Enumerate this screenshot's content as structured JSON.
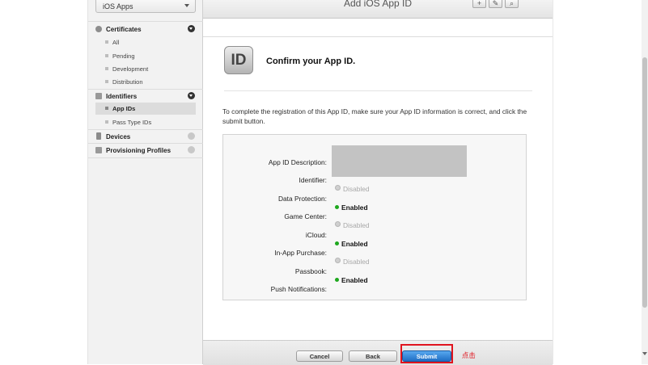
{
  "sidebar": {
    "platform_select": "iOS Apps",
    "sections": {
      "certificates": "Certificates",
      "identifiers": "Identifiers",
      "devices": "Devices",
      "provisioning": "Provisioning Profiles"
    },
    "certificate_items": [
      "All",
      "Pending",
      "Development",
      "Distribution"
    ],
    "identifier_items": [
      "App IDs",
      "Pass Type IDs"
    ],
    "active_item": "App IDs"
  },
  "header": {
    "title": "Add iOS App ID",
    "toolbar_add": "+",
    "toolbar_edit": "✎",
    "toolbar_search": "⌕"
  },
  "confirm": {
    "icon_text": "ID",
    "title": "Confirm your App ID.",
    "instructions": "To complete the registration of this App ID, make sure your App ID information is correct, and click the submit button."
  },
  "fields": {
    "labels": [
      "App ID Description:",
      "Identifier:",
      "Data Protection:",
      "Game Center:",
      "iCloud:",
      "In-App Purchase:",
      "Passbook:",
      "Push Notifications:"
    ],
    "statuses": [
      {
        "label": "Disabled",
        "state": "disabled"
      },
      {
        "label": "Enabled",
        "state": "enabled"
      },
      {
        "label": "Disabled",
        "state": "disabled"
      },
      {
        "label": "Enabled",
        "state": "enabled"
      },
      {
        "label": "Disabled",
        "state": "disabled"
      },
      {
        "label": "Enabled",
        "state": "enabled"
      }
    ]
  },
  "footer": {
    "cancel_label": "Cancel",
    "back_label": "Back",
    "submit_label": "Submit"
  },
  "annotation": {
    "text": "点击",
    "color": "#e0141e"
  },
  "colors": {
    "enabled_dot": "#1ea81e",
    "submit_blue": "#1f6ec4"
  }
}
